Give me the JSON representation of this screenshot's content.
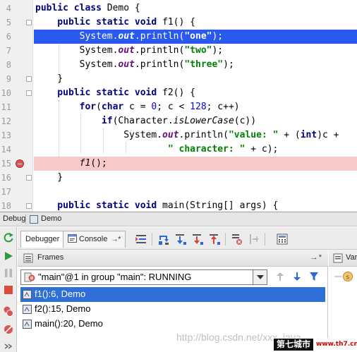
{
  "editor": {
    "lines": [
      {
        "num": "4"
      },
      {
        "num": "5"
      },
      {
        "num": "6"
      },
      {
        "num": "7"
      },
      {
        "num": "8"
      },
      {
        "num": "9"
      },
      {
        "num": "10"
      },
      {
        "num": "11"
      },
      {
        "num": "12"
      },
      {
        "num": "13"
      },
      {
        "num": "14"
      },
      {
        "num": "15"
      },
      {
        "num": "16"
      },
      {
        "num": "17"
      },
      {
        "num": "18"
      }
    ],
    "code": {
      "l4_a": "public class",
      "l4_b": " Demo {",
      "l5_a": "    public static void",
      "l5_b": " f1() {",
      "l6_a": "        System.",
      "l6_f": "out",
      "l6_b": ".println(",
      "l6_s": "\"one\"",
      "l6_c": ");",
      "l7_a": "        System.",
      "l7_f": "out",
      "l7_b": ".println(",
      "l7_s": "\"two\"",
      "l7_c": ");",
      "l8_a": "        System.",
      "l8_f": "out",
      "l8_b": ".println(",
      "l8_s": "\"three\"",
      "l8_c": ");",
      "l9": "    }",
      "l10_a": "    public static void",
      "l10_b": " f2() {",
      "l11_a": "        for",
      "l11_b": "(",
      "l11_k": "char",
      "l11_c": " c = ",
      "l11_n1": "0",
      "l11_d": "; c < ",
      "l11_n2": "128",
      "l11_e": "; c++)",
      "l12_a": "            if",
      "l12_b": "(Character.",
      "l12_i": "isLowerCase",
      "l12_c": "(c))",
      "l13_a": "                System.",
      "l13_f": "out",
      "l13_b": ".println(",
      "l13_s": "\"value: \"",
      "l13_c": " + (",
      "l13_k": "int",
      "l13_d": ")c +",
      "l14_pad": "                        ",
      "l14_s": "\" character: \"",
      "l14_c": " + c);",
      "l15_a": "        ",
      "l15_i": "f1",
      "l15_b": "();",
      "l16": "    }",
      "l17": "",
      "l18_a": "    public static void",
      "l18_b": " main(String[] args) {"
    }
  },
  "debug": {
    "window_label": "Debug",
    "config_tab": "Demo",
    "tabs": {
      "debugger": "Debugger",
      "console": "Console",
      "console_suffix": "→*"
    },
    "frames": {
      "title": "Frames",
      "header_arrows": "→*",
      "thread": "\"main\"@1 in group \"main\": RUNNING",
      "items": [
        {
          "label": "f1():6, Demo"
        },
        {
          "label": "f2():15, Demo"
        },
        {
          "label": "main():20, Demo"
        }
      ]
    },
    "variables": {
      "title": "Variables",
      "badge": "s"
    }
  },
  "overlay": {
    "watermark": "http://blog.csdn.net/xxx_java",
    "logo_text": "第七城市",
    "logo_sub": "www.th7.cn"
  },
  "colors": {
    "execution_line": "#2a59f0",
    "breakpoint_line": "#f9c9c9",
    "selected_frame": "#2f6fd8",
    "keyword": "#000080",
    "string": "#008000",
    "field": "#660e7a",
    "number": "#0000ff"
  }
}
